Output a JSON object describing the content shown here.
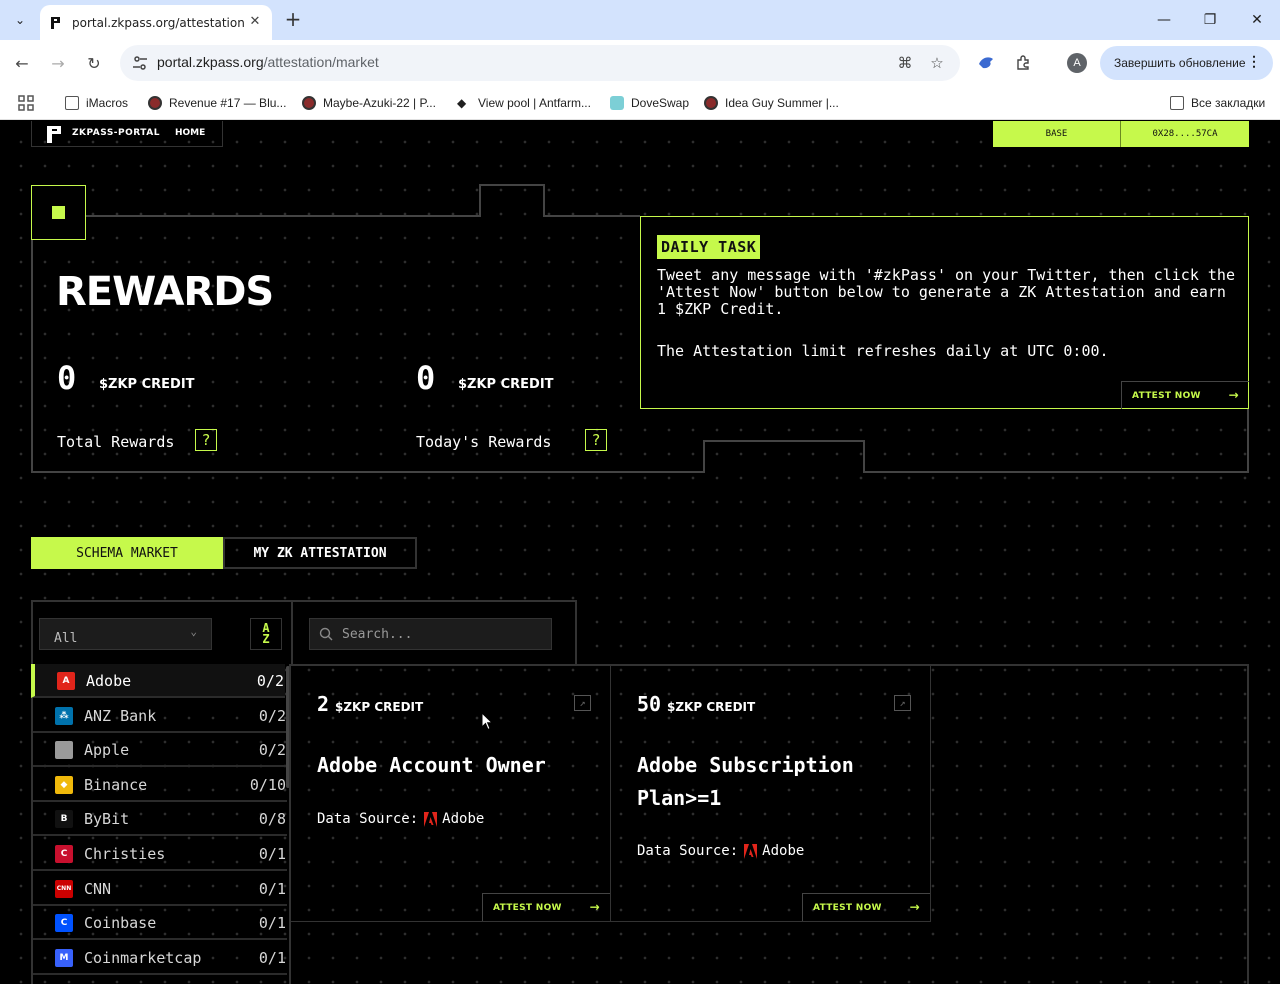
{
  "browser": {
    "tab_title": "portal.zkpass.org/attestation/m",
    "url_host": "portal.zkpass.org",
    "url_path": "/attestation/market",
    "update_label": "Завершить обновление",
    "avatar_letter": "A",
    "bookmarks": [
      {
        "label": "iMacros",
        "icon": "folder-icon"
      },
      {
        "label": "Revenue #17 — Blu...",
        "icon": "eye-icon"
      },
      {
        "label": "Maybe-Azuki-22 | P...",
        "icon": "eye-icon"
      },
      {
        "label": "View pool | Antfarm...",
        "icon": "diamond-icon"
      },
      {
        "label": "DoveSwap",
        "icon": "dove-icon"
      },
      {
        "label": "Idea Guy Summer |...",
        "icon": "eye-icon"
      }
    ],
    "all_bookmarks_label": "Все закладки"
  },
  "header": {
    "brand": "ZKPASS-PORTAL",
    "home": "HOME",
    "network": "BASE",
    "address": "0X28....57CA"
  },
  "rewards": {
    "title": "REWARDS",
    "total": {
      "value": "0",
      "unit": "$ZKP CREDIT",
      "label": "Total Rewards"
    },
    "today": {
      "value": "0",
      "unit": "$ZKP CREDIT",
      "label": "Today's Rewards"
    },
    "help": "?"
  },
  "daily_task": {
    "tag": "DAILY TASK",
    "text": "Tweet any message with '#zkPass' on your Twitter, then click the 'Attest Now' button below to generate a ZK Attestation and earn 1 $ZKP Credit.",
    "note": "The Attestation limit refreshes daily at UTC 0:00.",
    "button": "ATTEST NOW",
    "arrow": "→"
  },
  "tabs": {
    "schema_market": "SCHEMA MARKET",
    "my_zk": "MY ZK ATTESTATION"
  },
  "filters": {
    "category": "All",
    "sort_label": "A Z",
    "search_placeholder": "Search..."
  },
  "sidebar": {
    "items": [
      {
        "name": "Adobe",
        "count": "0/2",
        "icon": "adobe-icon",
        "color": "#e1251b",
        "glyph": "A"
      },
      {
        "name": "ANZ Bank",
        "count": "0/2",
        "icon": "anz-icon",
        "color": "#0072ac",
        "glyph": "⁂"
      },
      {
        "name": "Apple",
        "count": "0/2",
        "icon": "apple-icon",
        "color": "#9a9a9a",
        "glyph": ""
      },
      {
        "name": "Binance",
        "count": "0/10",
        "icon": "binance-icon",
        "color": "#f0b90b",
        "glyph": "◆"
      },
      {
        "name": "ByBit",
        "count": "0/8",
        "icon": "bybit-icon",
        "color": "#111111",
        "glyph": "B"
      },
      {
        "name": "Christies",
        "count": "0/1",
        "icon": "christies-icon",
        "color": "#c8102e",
        "glyph": "C"
      },
      {
        "name": "CNN",
        "count": "0/1",
        "icon": "cnn-icon",
        "color": "#cc0000",
        "glyph": "CNN"
      },
      {
        "name": "Coinbase",
        "count": "0/1",
        "icon": "coinbase-icon",
        "color": "#0052ff",
        "glyph": "C"
      },
      {
        "name": "Coinmarketcap",
        "count": "0/1",
        "icon": "coinmarketcap-icon",
        "color": "#3861fb",
        "glyph": "M"
      }
    ]
  },
  "cards": [
    {
      "amount": "2",
      "unit": "$ZKP CREDIT",
      "title": "Adobe Account Owner",
      "ds_label": "Data Source:",
      "ds_name": "Adobe",
      "button": "ATTEST NOW",
      "arrow": "→"
    },
    {
      "amount": "50",
      "unit": "$ZKP CREDIT",
      "title": "Adobe Subscription Plan>=1",
      "ds_label": "Data Source:",
      "ds_name": "Adobe",
      "button": "ATTEST NOW",
      "arrow": "→"
    }
  ],
  "colors": {
    "accent": "#c6f94b",
    "background": "#000000",
    "border": "#333333"
  }
}
